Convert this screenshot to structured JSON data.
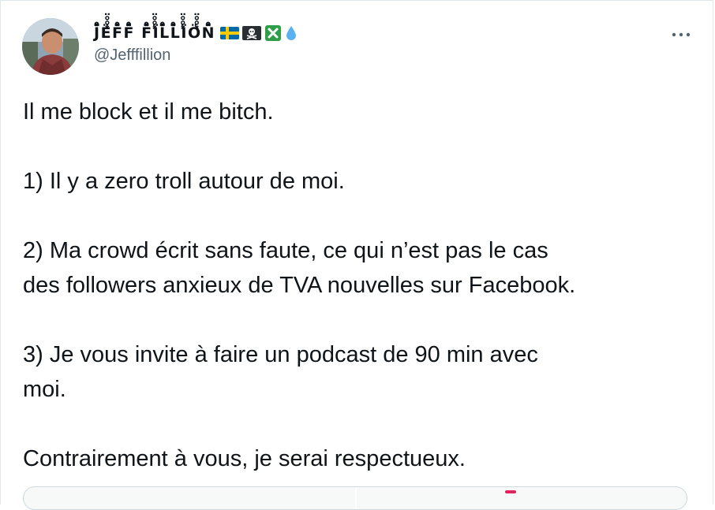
{
  "tweet": {
    "author": {
      "display_name": "J̈̽̊̊̈Ë̽̊̊̈F̈̽̊̊̈F̈̽̊̊̈ F̈̽̊̊̈Ï̽̊̊̈L̈̽̊̊̈L̈̽̊̊̈Ï̽̊̊̈Ö̽̊̊̈N̈̽̊̊̈",
      "handle": "@Jefffillion",
      "badges": [
        "sweden-flag-icon",
        "skull-crossbones-icon",
        "cross-mark-icon",
        "droplet-icon"
      ]
    },
    "more_label": "•••",
    "body_lines": [
      "Il me block et il me bitch.",
      "",
      "1) Il y a zero troll autour de moi.",
      "",
      "2) Ma crowd écrit sans faute, ce qui n’est pas le cas",
      "des followers anxieux de TVA nouvelles sur Facebook.",
      "",
      "3) Je vous invite à faire un podcast de 90 min avec",
      "moi.",
      "",
      "Contrairement à vous, je serai respectueux."
    ]
  },
  "colors": {
    "text": "#0f1419",
    "secondary_text": "#536471",
    "border": "#e1e8ed",
    "sweden_blue": "#006aa7",
    "sweden_yellow": "#fecc00",
    "cross_green": "#2e9e49",
    "droplet_blue": "#5ab1f0"
  }
}
